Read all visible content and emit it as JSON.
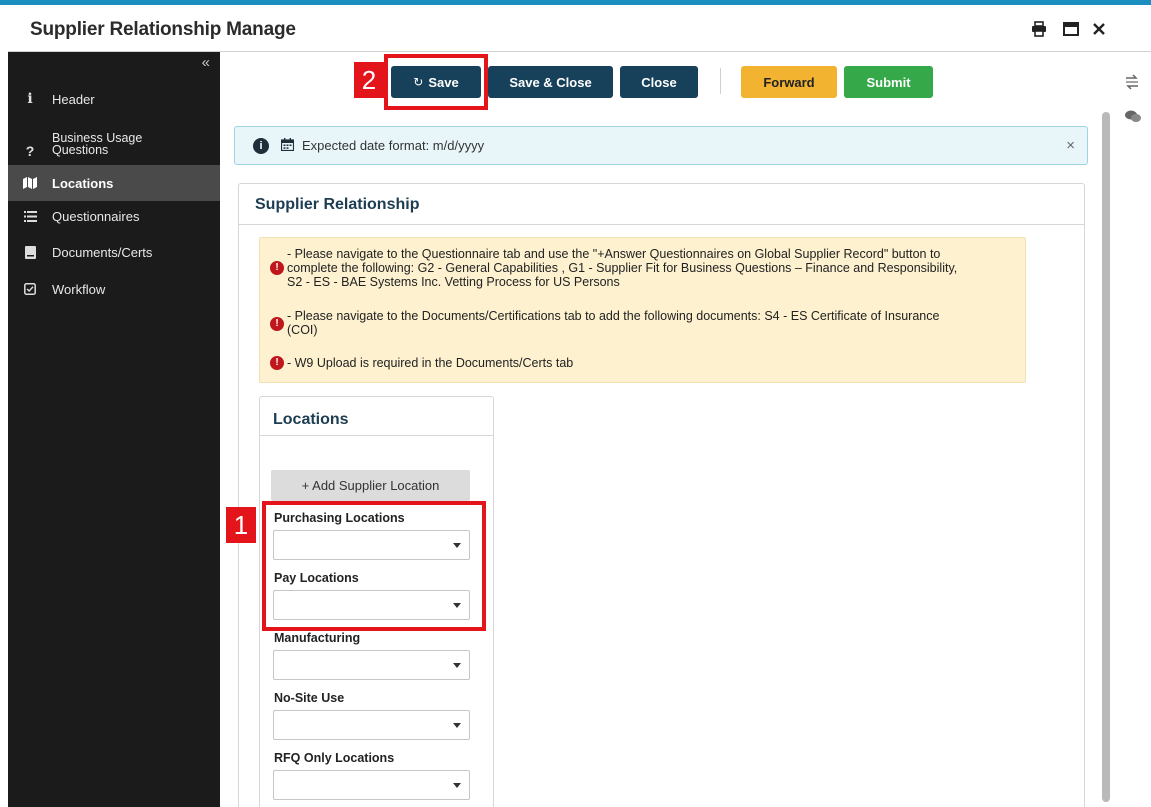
{
  "window": {
    "title": "Supplier Relationship Manage",
    "print_icon": "print-icon",
    "maximize_icon": "window-maximize-icon",
    "close_icon": "close-icon"
  },
  "sidebar": {
    "collapse_icon": "«",
    "items": [
      {
        "label": "Header",
        "icon": "i",
        "active": false
      },
      {
        "label": "Business Usage Questions",
        "icon": "?",
        "active": false
      },
      {
        "label": "Locations",
        "icon": "map-icon",
        "active": true
      },
      {
        "label": "Questionnaires",
        "icon": "list-icon",
        "active": false
      },
      {
        "label": "Documents/Certs",
        "icon": "document-icon",
        "active": false
      },
      {
        "label": "Workflow",
        "icon": "check-square-icon",
        "active": false
      }
    ]
  },
  "toolbar": {
    "save": "Save",
    "save_close": "Save & Close",
    "close": "Close",
    "forward": "Forward",
    "submit": "Submit"
  },
  "annotations": {
    "one": "1",
    "two": "2"
  },
  "info_alert": {
    "text": "Expected date format: m/d/yyyy",
    "close": "×"
  },
  "panel": {
    "title": "Supplier Relationship",
    "warnings": [
      "- Please navigate to the Questionnaire tab and use the \"+Answer Questionnaires on Global Supplier Record\" button to",
      "complete the following: G2 - General Capabilities , G1 - Supplier Fit for Business Questions – Finance and Responsibility,",
      "S2 - ES - BAE Systems Inc. Vetting Process for US Persons",
      "- Please navigate to the Documents/Certifications tab to add the following documents: S4 - ES Certificate of Insurance",
      "(COI)",
      "- W9 Upload is required in the Documents/Certs tab"
    ]
  },
  "locations": {
    "title": "Locations",
    "add_button": "+ Add Supplier Location",
    "fields": [
      {
        "label": "Purchasing Locations",
        "value": ""
      },
      {
        "label": "Pay Locations",
        "value": ""
      },
      {
        "label": "Manufacturing",
        "value": ""
      },
      {
        "label": "No-Site Use",
        "value": ""
      },
      {
        "label": "RFQ Only Locations",
        "value": ""
      }
    ]
  },
  "colors": {
    "accent": "#17415b",
    "forward": "#f2b430",
    "submit": "#35a84a",
    "annotation": "#e3151b",
    "sidebar_bg": "#1b1b1b",
    "warning_bg": "#fdf1cf"
  }
}
